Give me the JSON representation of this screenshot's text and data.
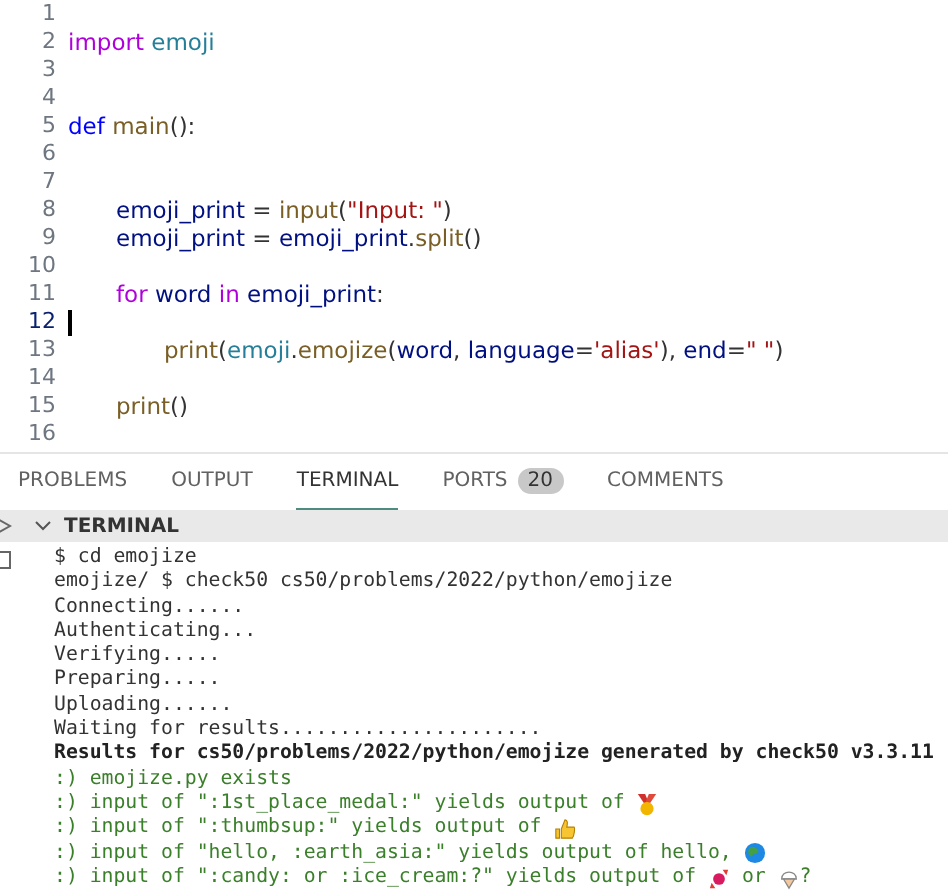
{
  "editor": {
    "lines": [
      {
        "number": "1",
        "current": false,
        "kind": "blank"
      },
      {
        "number": "2",
        "current": false,
        "kind": "top",
        "tokens": [
          {
            "text": "import ",
            "kind": "keyword"
          },
          {
            "text": "emoji",
            "kind": "module"
          }
        ]
      },
      {
        "number": "3",
        "current": false,
        "kind": "blank"
      },
      {
        "number": "4",
        "current": false,
        "kind": "blank"
      },
      {
        "number": "5",
        "current": false,
        "kind": "top",
        "tokens": [
          {
            "text": "def ",
            "kind": "storage"
          },
          {
            "text": "main",
            "kind": "function"
          },
          {
            "text": "():",
            "kind": "plain"
          }
        ]
      },
      {
        "number": "6",
        "current": false,
        "kind": "blank"
      },
      {
        "number": "7",
        "current": false,
        "kind": "blank"
      },
      {
        "number": "8",
        "current": false,
        "kind": "block",
        "tokens": [
          {
            "text": "emoji_print",
            "kind": "variable"
          },
          {
            "text": " = ",
            "kind": "plain"
          },
          {
            "text": "input",
            "kind": "function"
          },
          {
            "text": "(",
            "kind": "plain"
          },
          {
            "text": "\"Input: \"",
            "kind": "string"
          },
          {
            "text": ")",
            "kind": "plain"
          }
        ]
      },
      {
        "number": "9",
        "current": false,
        "kind": "block",
        "tokens": [
          {
            "text": "emoji_print",
            "kind": "variable"
          },
          {
            "text": " = ",
            "kind": "plain"
          },
          {
            "text": "emoji_print",
            "kind": "variable"
          },
          {
            "text": ".",
            "kind": "plain"
          },
          {
            "text": "split",
            "kind": "function"
          },
          {
            "text": "()",
            "kind": "plain"
          }
        ]
      },
      {
        "number": "10",
        "current": false,
        "kind": "blank"
      },
      {
        "number": "11",
        "current": false,
        "kind": "block",
        "tokens": [
          {
            "text": "for ",
            "kind": "keyword"
          },
          {
            "text": "word ",
            "kind": "variable"
          },
          {
            "text": "in ",
            "kind": "keyword"
          },
          {
            "text": "emoji_print",
            "kind": "variable"
          },
          {
            "text": ":",
            "kind": "plain"
          }
        ]
      },
      {
        "number": "12",
        "current": true,
        "kind": "blank"
      },
      {
        "number": "13",
        "current": false,
        "kind": "inner",
        "tokens": [
          {
            "text": "print",
            "kind": "function"
          },
          {
            "text": "(",
            "kind": "plain"
          },
          {
            "text": "emoji",
            "kind": "module"
          },
          {
            "text": ".",
            "kind": "plain"
          },
          {
            "text": "emojize",
            "kind": "function"
          },
          {
            "text": "(",
            "kind": "plain"
          },
          {
            "text": "word",
            "kind": "variable"
          },
          {
            "text": ", ",
            "kind": "plain"
          },
          {
            "text": "language",
            "kind": "variable"
          },
          {
            "text": "=",
            "kind": "plain"
          },
          {
            "text": "'alias'",
            "kind": "string"
          },
          {
            "text": "), ",
            "kind": "plain"
          },
          {
            "text": "end",
            "kind": "variable"
          },
          {
            "text": "=",
            "kind": "plain"
          },
          {
            "text": "\" \"",
            "kind": "string"
          },
          {
            "text": ")",
            "kind": "plain"
          }
        ]
      },
      {
        "number": "14",
        "current": false,
        "kind": "blank"
      },
      {
        "number": "15",
        "current": false,
        "kind": "block",
        "tokens": [
          {
            "text": "print",
            "kind": "function"
          },
          {
            "text": "()",
            "kind": "plain"
          }
        ]
      },
      {
        "number": "16",
        "current": false,
        "kind": "blank"
      }
    ]
  },
  "panel": {
    "tabs": [
      {
        "label": "PROBLEMS",
        "selected": false
      },
      {
        "label": "OUTPUT",
        "selected": false
      },
      {
        "label": "TERMINAL",
        "selected": true
      },
      {
        "label": "PORTS",
        "selected": false,
        "badge": "20"
      },
      {
        "label": "COMMENTS",
        "selected": false
      }
    ],
    "section_title": "TERMINAL",
    "terminal_lines": [
      {
        "kind": "plain",
        "parts": [
          {
            "kind": "text",
            "text": "$ cd emojize"
          }
        ]
      },
      {
        "kind": "plain",
        "parts": [
          {
            "kind": "text",
            "text": "emojize/ $ check50 cs50/problems/2022/python/emojize"
          }
        ]
      },
      {
        "kind": "plain",
        "parts": [
          {
            "kind": "text",
            "text": "Connecting......"
          }
        ]
      },
      {
        "kind": "plain",
        "parts": [
          {
            "kind": "text",
            "text": "Authenticating..."
          }
        ]
      },
      {
        "kind": "plain",
        "parts": [
          {
            "kind": "text",
            "text": "Verifying....."
          }
        ]
      },
      {
        "kind": "plain",
        "parts": [
          {
            "kind": "text",
            "text": "Preparing....."
          }
        ]
      },
      {
        "kind": "plain",
        "parts": [
          {
            "kind": "text",
            "text": "Uploading......"
          }
        ]
      },
      {
        "kind": "plain",
        "parts": [
          {
            "kind": "text",
            "text": "Waiting for results......................"
          }
        ]
      },
      {
        "kind": "bold",
        "parts": [
          {
            "kind": "text",
            "text": "Results for cs50/problems/2022/python/emojize generated by check50 v3.3.11"
          }
        ]
      },
      {
        "kind": "pass",
        "parts": [
          {
            "kind": "text",
            "text": ":) emojize.py exists"
          }
        ]
      },
      {
        "kind": "pass",
        "parts": [
          {
            "kind": "text",
            "text": ":) input of \":1st_place_medal:\" yields output of "
          },
          {
            "kind": "medal"
          }
        ]
      },
      {
        "kind": "pass",
        "parts": [
          {
            "kind": "text",
            "text": ":) input of \":thumbsup:\" yields output of "
          },
          {
            "kind": "thumb"
          }
        ]
      },
      {
        "kind": "pass",
        "parts": [
          {
            "kind": "text",
            "text": ":) input of \"hello, :earth_asia:\" yields output of hello, "
          },
          {
            "kind": "globe"
          }
        ]
      },
      {
        "kind": "pass",
        "parts": [
          {
            "kind": "text",
            "text": ":) input of \":candy: or :ice_cream:?\" yields output of "
          },
          {
            "kind": "candy"
          },
          {
            "kind": "text",
            "text": " or "
          },
          {
            "kind": "icecream"
          },
          {
            "kind": "text",
            "text": "?"
          }
        ]
      }
    ]
  }
}
